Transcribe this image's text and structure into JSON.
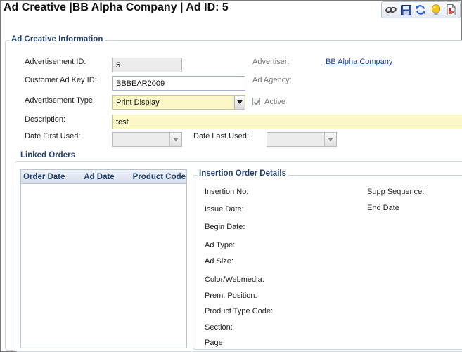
{
  "header": {
    "title": "Ad Creative |BB Alpha Company | Ad ID: 5"
  },
  "toolbar": {
    "buttons": [
      {
        "name": "link-icon"
      },
      {
        "name": "save-icon"
      },
      {
        "name": "refresh-icon"
      },
      {
        "name": "lightbulb-icon"
      },
      {
        "name": "document-icon"
      }
    ]
  },
  "ad_creative_info": {
    "legend": "Ad Creative Information",
    "advertisement_id": {
      "label": "Advertisement ID:",
      "value": "5"
    },
    "customer_ad_key_id": {
      "label": "Customer Ad Key ID:",
      "value": "BBBEAR2009"
    },
    "advertisement_type": {
      "label": "Advertisement Type:",
      "value": "Print Display"
    },
    "description": {
      "label": "Description:",
      "value": "test"
    },
    "date_first_used": {
      "label": "Date First Used:",
      "value": ""
    },
    "date_last_used": {
      "label": "Date Last Used:",
      "value": ""
    },
    "advertiser": {
      "label": "Advertiser:",
      "value": "BB Alpha Company"
    },
    "ad_agency": {
      "label": "Ad Agency:",
      "value": ""
    },
    "active": {
      "label": "Active",
      "checked": true
    }
  },
  "linked_orders": {
    "legend": "Linked Orders",
    "columns": [
      "Order Date",
      "Ad Date",
      "Product Code"
    ],
    "rows": []
  },
  "insertion_order_details": {
    "legend": "Insertion Order Details",
    "left_fields": [
      "Insertion No:",
      "Issue Date:",
      "Begin Date:",
      "Ad Type:",
      "Ad Size:",
      "Color/Webmedia:",
      "Prem. Position:",
      "Product Type Code:",
      "Section:",
      "Page"
    ],
    "right_fields": [
      "Supp Sequence:",
      "End Date"
    ]
  },
  "colors": {
    "legend_text": "#24426e",
    "required_bg": "#fbf7c6",
    "readonly_bg": "#ececec",
    "link": "#1f3f9a"
  }
}
